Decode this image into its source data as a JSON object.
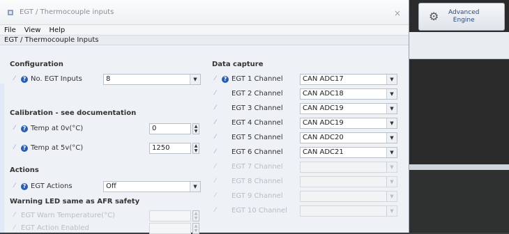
{
  "window": {
    "title": "EGT / Thermocouple inputs",
    "close_glyph": "×"
  },
  "menu": {
    "file": "File",
    "view": "View",
    "help": "Help"
  },
  "panel_header": "EGT / Thermocouple Inputs",
  "configuration": {
    "title": "Configuration",
    "no_egt_label": "No. EGT Inputs",
    "no_egt_value": "8"
  },
  "calibration": {
    "title": "Calibration - see documentation",
    "temp0_label": "Temp at 0v(°C)",
    "temp0_value": "0",
    "temp5_label": "Temp at 5v(°C)",
    "temp5_value": "1250"
  },
  "actions": {
    "title": "Actions",
    "egt_actions_label": "EGT Actions",
    "egt_actions_value": "Off"
  },
  "warning": {
    "title": "Warning LED same as AFR safety",
    "warn_temp_label": "EGT Warn Temperature(°C)",
    "warn_temp_value": "",
    "action_label": "EGT Action Enabled",
    "action_value": ""
  },
  "data_capture": {
    "title": "Data capture",
    "channels": [
      {
        "label": "EGT 1 Channel",
        "value": "CAN ADC17",
        "enabled": true
      },
      {
        "label": "EGT 2 Channel",
        "value": "CAN ADC18",
        "enabled": true
      },
      {
        "label": "EGT 3 Channel",
        "value": "CAN ADC19",
        "enabled": true
      },
      {
        "label": "EGT 4 Channel",
        "value": "CAN ADC19",
        "enabled": true
      },
      {
        "label": "EGT 5 Channel",
        "value": "CAN ADC20",
        "enabled": true
      },
      {
        "label": "EGT 6 Channel",
        "value": "CAN ADC21",
        "enabled": true
      },
      {
        "label": "EGT 7 Channel",
        "value": "",
        "enabled": false
      },
      {
        "label": "EGT 8 Channel",
        "value": "",
        "enabled": false
      },
      {
        "label": "EGT 9 Channel",
        "value": "",
        "enabled": false
      },
      {
        "label": "EGT 10 Channel",
        "value": "",
        "enabled": false
      }
    ]
  },
  "advanced_engine": {
    "line1": "Advanced",
    "line2": "Engine",
    "icon": "cog-icon"
  },
  "colors": {
    "accent": "#2a5db0",
    "bg": "#eef1f5",
    "dark": "#2b2b2b"
  }
}
